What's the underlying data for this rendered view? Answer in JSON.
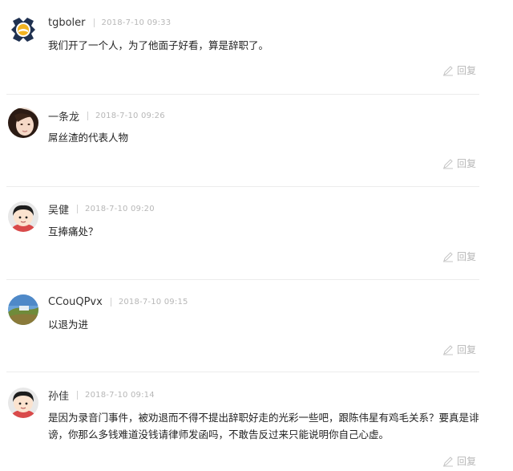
{
  "comments": [
    {
      "name": "tgboler",
      "time": "2018-7-10 09:33",
      "text": "我们开了一个人，为了他面子好看，算是辞职了。",
      "reply": "回复",
      "avatar": "logo-avatar"
    },
    {
      "name": "一条龙",
      "time": "2018-7-10 09:26",
      "text": "屌丝渣的代表人物",
      "reply": "回复",
      "avatar": "woman-photo-avatar"
    },
    {
      "name": "吴健",
      "time": "2018-7-10 09:20",
      "text": "互捧痛处？",
      "reply": "回复",
      "avatar": "cartoon-avatar"
    },
    {
      "name": "CCouQPvx",
      "time": "2018-7-10 09:15",
      "text": "以退为进",
      "reply": "回复",
      "avatar": "landscape-avatar"
    },
    {
      "name": "孙佳",
      "time": "2018-7-10 09:14",
      "text": "是因为录音门事件，被劝退而不得不提出辞职好走的光彩一些吧，跟陈伟星有鸡毛关系？要真是诽谤，你那么多钱难道没钱请律师发函吗，不敢告反过来只能说明你自己心虚。",
      "reply": "回复",
      "avatar": "cartoon-avatar"
    }
  ],
  "colors": {
    "meta": "#b7b7b7",
    "divider": "#ececec",
    "reply": "#b8b8b8"
  }
}
